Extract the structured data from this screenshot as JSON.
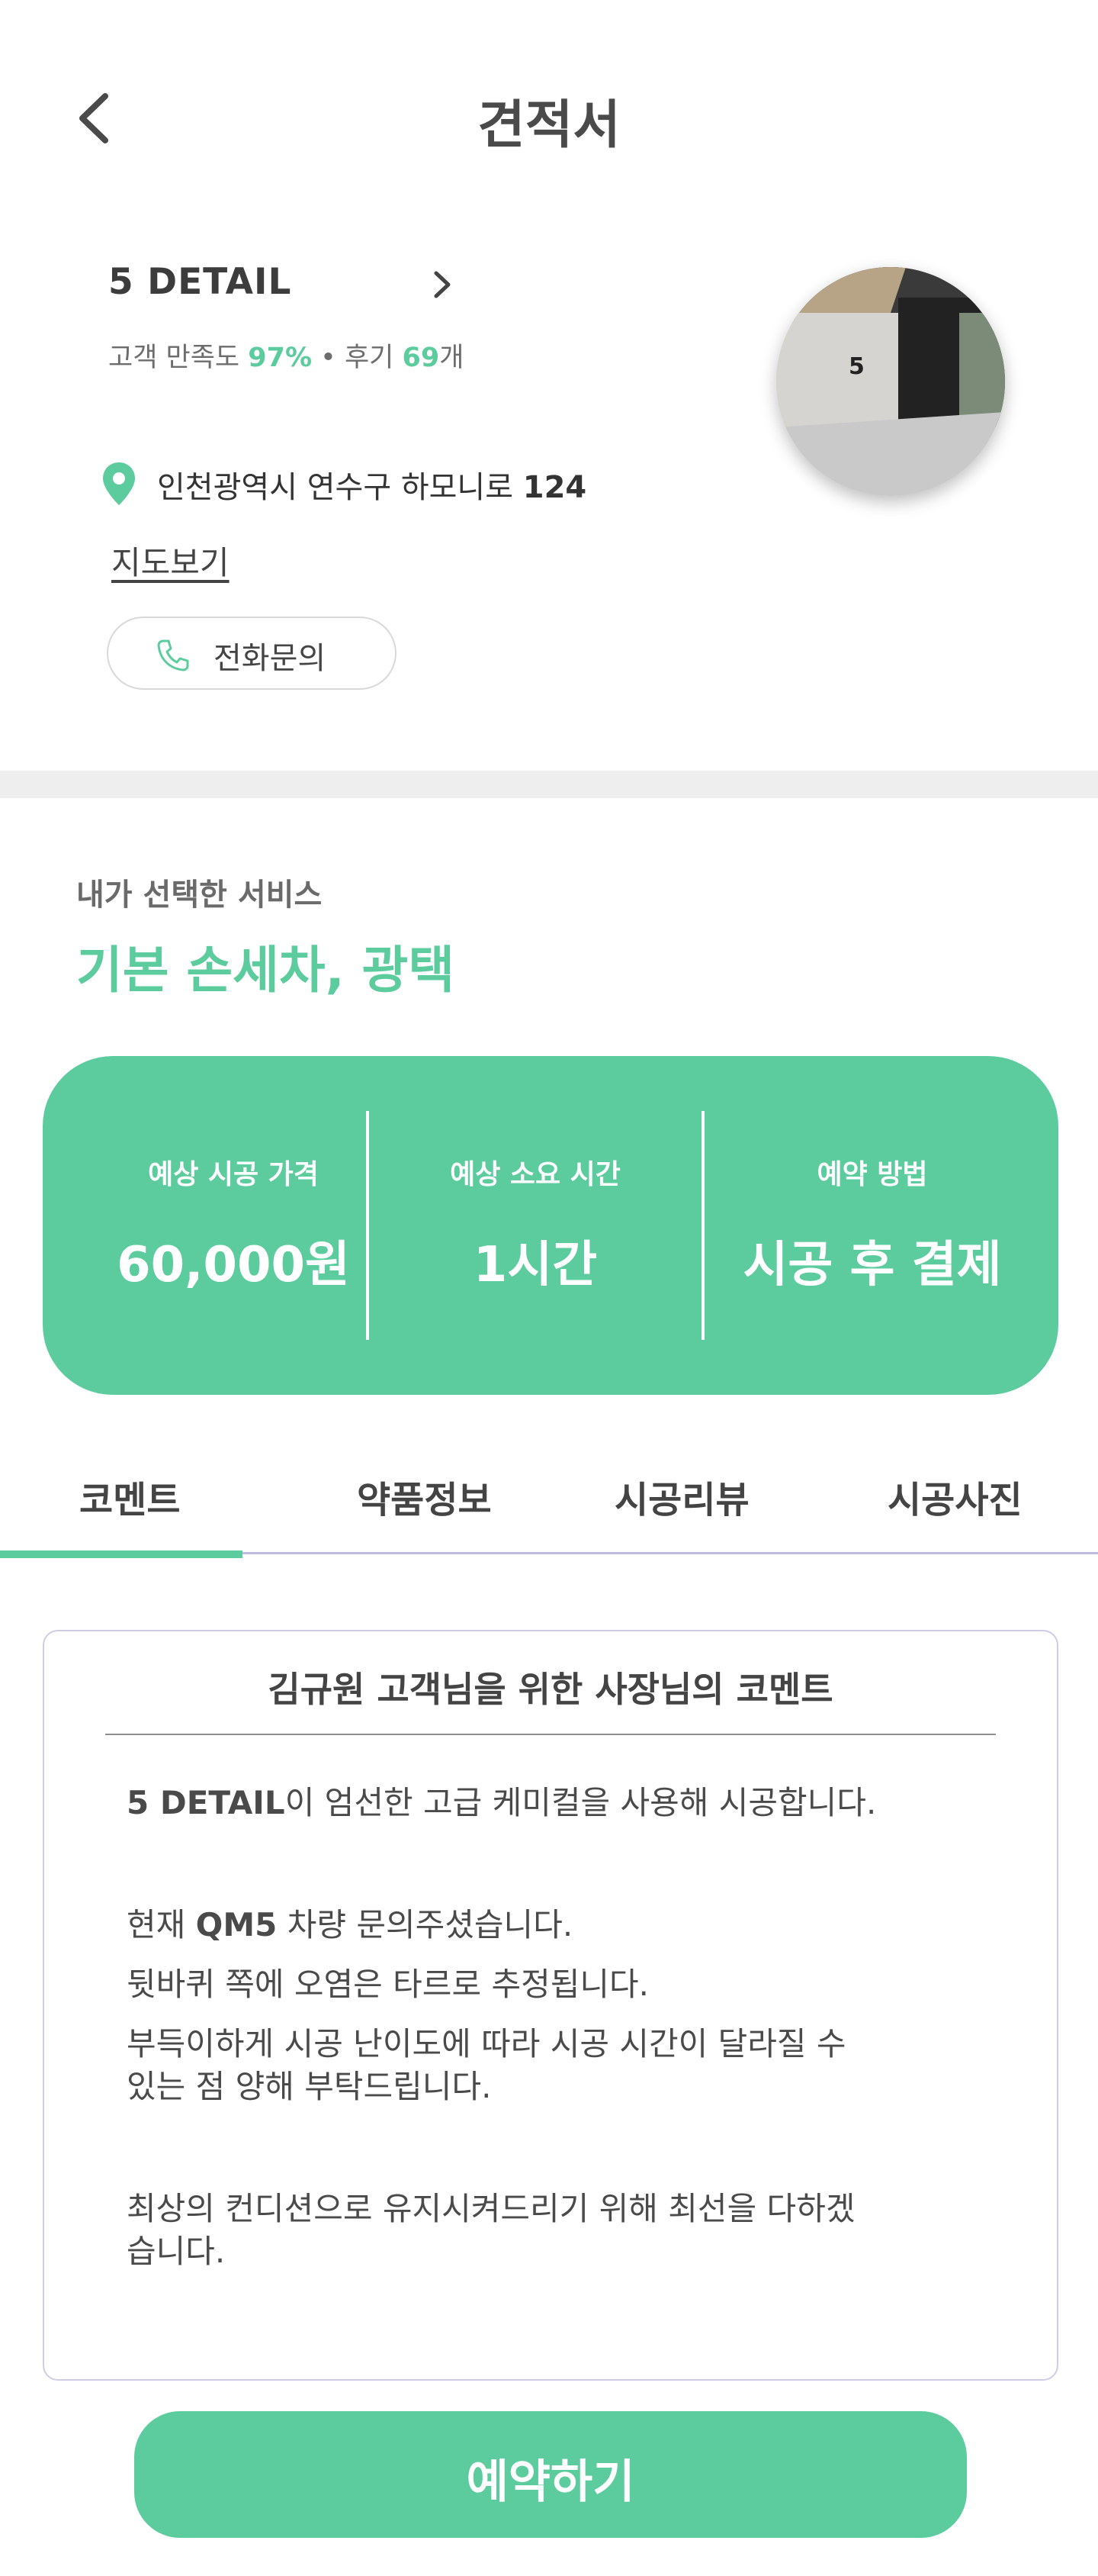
{
  "header": {
    "title": "견적서"
  },
  "shop": {
    "name": "5 DETAIL",
    "satisfaction_label": "고객 만족도 ",
    "satisfaction_value": "97%",
    "separator": " • 후기 ",
    "review_count": "69",
    "review_unit": "개",
    "address_prefix": "인천광역시 연수구 하모니로 ",
    "address_number": "124",
    "map_link": "지도보기",
    "phone_button": "전화문의"
  },
  "service": {
    "section_label": "내가 선택한 서비스",
    "name": "기본 손세차, 광택"
  },
  "summary": {
    "price_label": "예상 시공 가격",
    "price_value": "60,000원",
    "time_label": "예상 소요 시간",
    "time_value": "1시간",
    "method_label": "예약 방법",
    "method_value": "시공 후 결제"
  },
  "tabs": [
    "코멘트",
    "약품정보",
    "시공리뷰",
    "시공사진"
  ],
  "comment": {
    "title": "김규원 고객님을 위한 사장님의 코멘트",
    "line1_bold": "5 DETAIL",
    "line1_rest": "이 엄선한 고급 케미컬을 사용해 시공합니다.",
    "line2_pre": "현재 ",
    "line2_bold": "QM5",
    "line2_rest": " 차량 문의주셨습니다.",
    "line3": "뒷바퀴 쪽에 오염은 타르로 추정됩니다.",
    "line4a": "부득이하게 시공 난이도에 따라 시공 시간이 달라질 수",
    "line4b": "있는 점 양해 부탁드립니다.",
    "line5a": "최상의 컨디션으로 유지시켜드리기 위해 최선을 다하겠",
    "line5b": "습니다."
  },
  "cta": {
    "reserve": "예약하기"
  },
  "colors": {
    "accent": "#5ccc9f",
    "text": "#3a3a3a",
    "tab_line": "#bdbce0"
  },
  "icons": {
    "back": "chevron-left-icon",
    "shop_link": "chevron-right-icon",
    "location": "map-pin-icon",
    "phone": "phone-icon"
  }
}
